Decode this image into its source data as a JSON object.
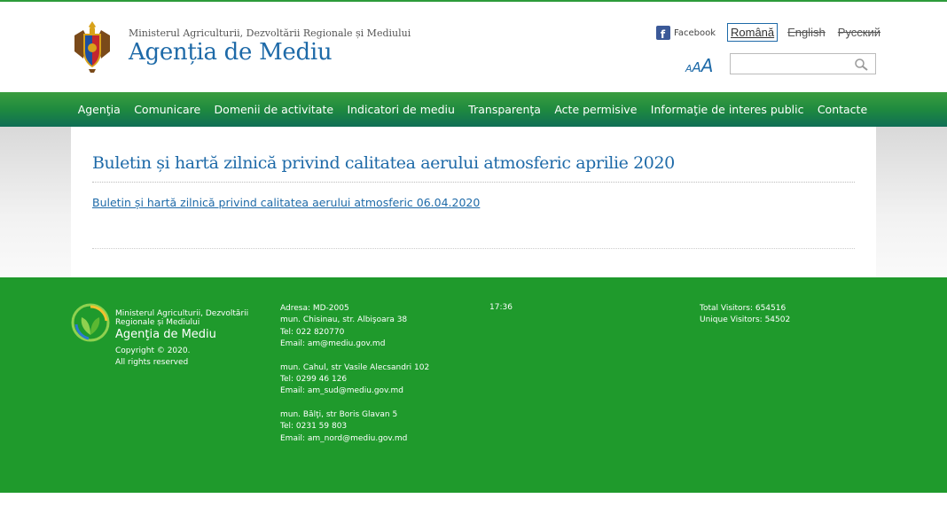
{
  "header": {
    "ministry": "Ministerul Agriculturii, Dezvoltării Regionale și Mediului",
    "agency": "Agenția de Mediu",
    "facebook": "Facebook",
    "languages": [
      "Română",
      "English",
      "Русский"
    ],
    "active_language": "Română",
    "font_size_labels": [
      "A",
      "A",
      "A"
    ],
    "search_placeholder": ""
  },
  "nav": {
    "items": [
      "Agenţia",
      "Comunicare",
      "Domenii de activitate",
      "Indicatori de mediu",
      "Transparenţa",
      "Acte permisive",
      "Informaţie de interes public",
      "Contacte"
    ]
  },
  "main": {
    "title": "Buletin și hartă zilnică privind calitatea aerului atmosferic aprilie 2020",
    "link": "Buletin și hartă zilnică privind calitatea aerului atmosferic 06.04.2020"
  },
  "footer": {
    "ministry": "Ministerul Agriculturii, Dezvoltării Regionale și Mediului",
    "agency": "Agenţia de Mediu",
    "copyright": "Copyright © 2020.",
    "rights": "All rights reserved",
    "addresses": [
      [
        "Adresa: MD-2005",
        "mun. Chisinau, str. Albişoara 38",
        "Tel: 022 820770",
        "Email: am@mediu.gov.md"
      ],
      [
        "mun. Cahul, str Vasile Alecsandri 102",
        "Tel: 0299 46 126",
        "Email: am_sud@mediu.gov.md"
      ],
      [
        "mun. Bălţi, str Boris Glavan 5",
        "Tel: 0231 59 803",
        "Email: am_nord@mediu.gov.md"
      ]
    ],
    "time": "17:36",
    "total_visitors": "Total Visitors: 654516",
    "unique_visitors": "Unique Visitors: 54502"
  },
  "colors": {
    "brand_blue": "#1e6aa8",
    "nav_green": "#1f8a3f",
    "footer_green": "#1f9a2c"
  }
}
